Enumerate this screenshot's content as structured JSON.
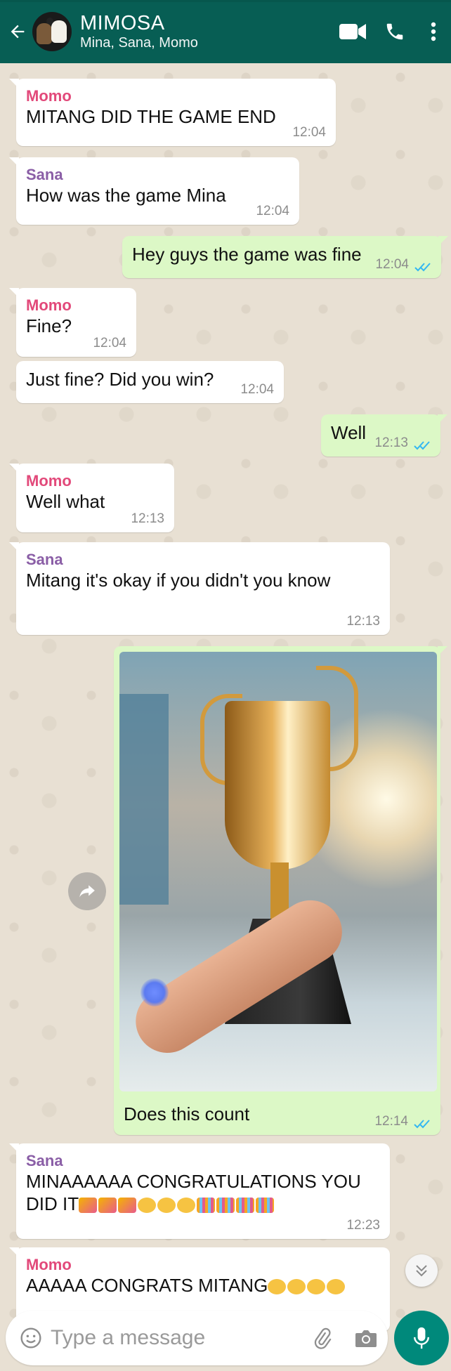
{
  "header": {
    "title": "MIMOSA",
    "subtitle": "Mina, Sana, Momo"
  },
  "messages": [
    {
      "sender": "Momo",
      "text": "MITANG DID THE GAME END",
      "time": "12:04"
    },
    {
      "sender": "Sana",
      "text": "How was the game Mina",
      "time": "12:04"
    },
    {
      "text": "Hey guys the game was fine",
      "time": "12:04"
    },
    {
      "sender": "Momo",
      "text": "Fine?",
      "time": "12:04"
    },
    {
      "text": "Just fine? Did you win?",
      "time": "12:04"
    },
    {
      "text": "Well",
      "time": "12:13"
    },
    {
      "sender": "Momo",
      "text": "Well what",
      "time": "12:13"
    },
    {
      "sender": "Sana",
      "text": "Mitang it's okay if you didn't you know",
      "time": "12:13"
    },
    {
      "caption": "Does this count",
      "time": "12:14"
    },
    {
      "sender": "Sana",
      "text_line1": "MINAAAAAA CONGRATULATIONS YOU",
      "text_line2": "DID IT",
      "time": "12:23"
    },
    {
      "sender": "Momo",
      "text": "AAAAA CONGRATS MITANG"
    }
  ],
  "composer": {
    "placeholder": "Type a message"
  },
  "colors": {
    "header": "#075e54",
    "outgoing": "#dcf8c6",
    "incoming": "#ffffff",
    "momo": "#e2497a",
    "sana": "#8a5ea6",
    "ticks": "#34b7f1",
    "mic": "#00897b"
  },
  "icons": [
    "back-arrow-icon",
    "video-call-icon",
    "voice-call-icon",
    "more-options-icon",
    "forward-icon",
    "scroll-down-icon",
    "emoji-icon",
    "attach-icon",
    "camera-icon",
    "mic-icon"
  ]
}
